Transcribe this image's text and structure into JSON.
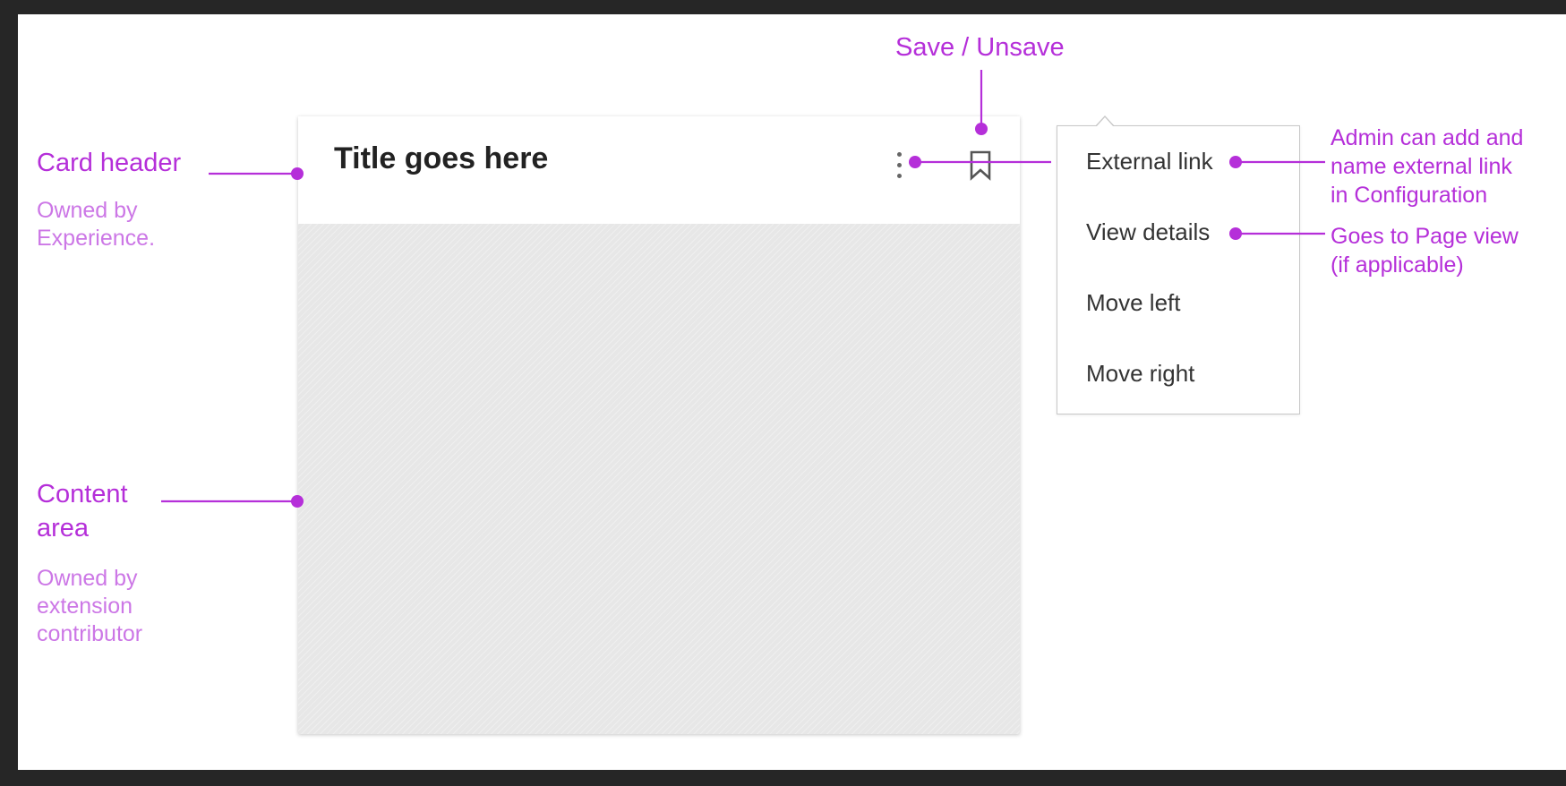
{
  "card": {
    "title": "Title goes here"
  },
  "menu": {
    "items": [
      {
        "label": "External link"
      },
      {
        "label": "View details"
      },
      {
        "label": "Move left"
      },
      {
        "label": "Move right"
      }
    ]
  },
  "annotations": {
    "save": {
      "label": "Save / Unsave"
    },
    "card_header": {
      "title": "Card header",
      "subtitle_lines": [
        "Owned by",
        "Experience."
      ]
    },
    "content_area": {
      "title_lines": [
        "Content",
        "area"
      ],
      "subtitle_lines": [
        "Owned by",
        "extension",
        "contributor"
      ]
    },
    "external_link": {
      "lines": [
        "Admin can add and",
        "name external link",
        "in Configuration"
      ]
    },
    "view_details": {
      "lines": [
        "Goes to Page view",
        "(if applicable)"
      ]
    }
  },
  "icons": {
    "more": "kebab-vertical-icon",
    "save": "bookmark-icon"
  },
  "colors": {
    "annotation": "#b52fd9",
    "annotation_light": "#cc77e6",
    "content_area_fill": "#e7e7e7",
    "frame": "#262626"
  }
}
